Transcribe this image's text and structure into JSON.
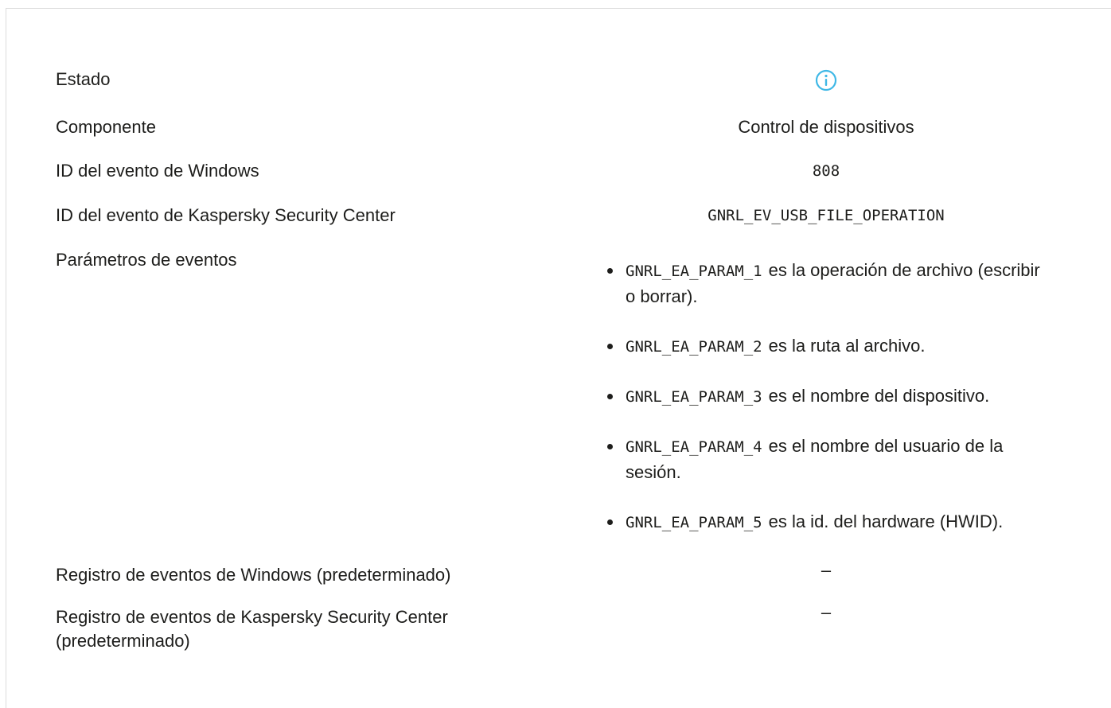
{
  "rows": {
    "estado": {
      "label": "Estado",
      "icon": "info-icon"
    },
    "componente": {
      "label": "Componente",
      "value": "Control de dispositivos"
    },
    "windows_event_id": {
      "label": "ID del evento de Windows",
      "value": "808"
    },
    "ksc_event_id": {
      "label": "ID del evento de Kaspersky Security Center",
      "value": "GNRL_EV_USB_FILE_OPERATION"
    },
    "event_params": {
      "label": "Parámetros de eventos",
      "items": [
        {
          "code": "GNRL_EA_PARAM_1",
          "text": "es la operación de archivo (escribir o borrar)."
        },
        {
          "code": "GNRL_EA_PARAM_2",
          "text": "es la ruta al archivo."
        },
        {
          "code": "GNRL_EA_PARAM_3",
          "text": "es el nombre del dispositivo."
        },
        {
          "code": "GNRL_EA_PARAM_4",
          "text": "es el nombre del usuario de la sesión."
        },
        {
          "code": "GNRL_EA_PARAM_5",
          "text": "es la id. del hardware (HWID)."
        }
      ]
    },
    "windows_log": {
      "label": "Registro de eventos de Windows (predeterminado)",
      "value": "–"
    },
    "ksc_log": {
      "label": "Registro de eventos de Kaspersky Security Center (predeterminado)",
      "value": "–"
    }
  },
  "colors": {
    "info_icon": "#3fb8e6",
    "text": "#1d1d1b",
    "border": "#dcdcdc"
  }
}
